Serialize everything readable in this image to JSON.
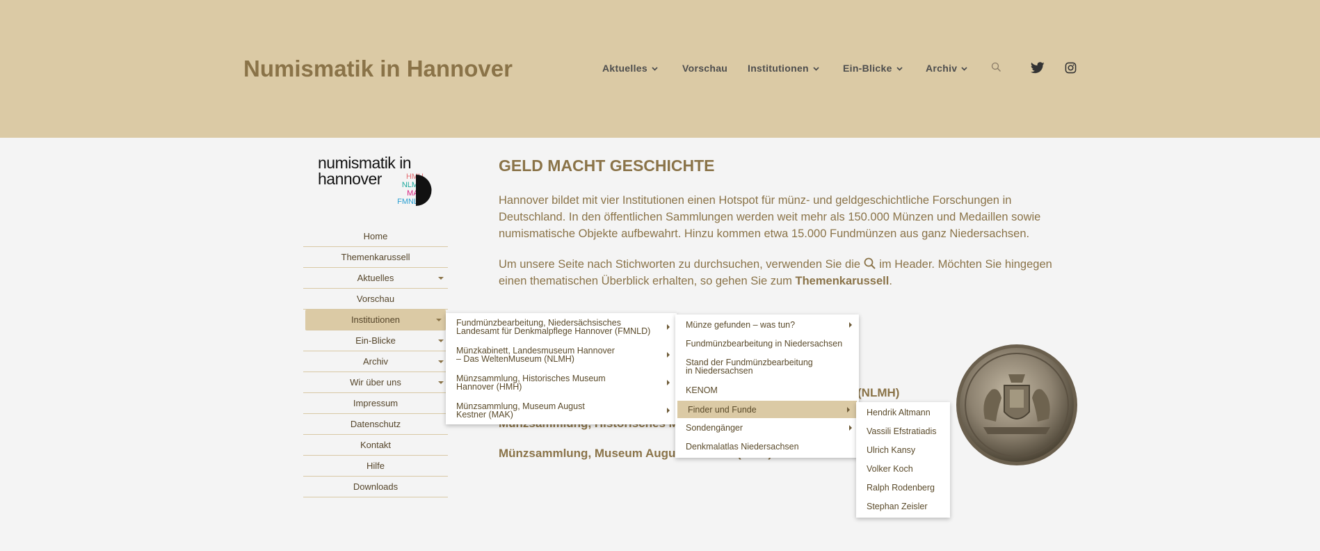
{
  "header": {
    "site_title": "Numismatik in Hannover",
    "nav": [
      {
        "label": "Aktuelles"
      },
      {
        "label": "Vorschau"
      },
      {
        "label": "Institutionen"
      },
      {
        "label": "Ein-Blicke"
      },
      {
        "label": "Archiv"
      }
    ],
    "icons": [
      "search-icon",
      "twitter-icon",
      "instagram-icon"
    ]
  },
  "logo": {
    "line1": "numismatik in",
    "line2": "hannover",
    "abbr": [
      "HMH",
      "NLMH",
      "MAK",
      "FMNLD"
    ],
    "abbr_colors": [
      "#e36f73",
      "#1aa89b",
      "#d6207f",
      "#2b9fd1"
    ]
  },
  "sidebar": {
    "items": [
      {
        "label": "Home"
      },
      {
        "label": "Themenkarussell"
      },
      {
        "label": "Aktuelles"
      },
      {
        "label": "Vorschau"
      },
      {
        "label": "Institutionen"
      },
      {
        "label": "Ein-Blicke"
      },
      {
        "label": "Archiv"
      },
      {
        "label": "Wir über uns"
      },
      {
        "label": "Impressum"
      },
      {
        "label": "Datenschutz"
      },
      {
        "label": "Kontakt"
      },
      {
        "label": "Hilfe"
      },
      {
        "label": "Downloads"
      }
    ]
  },
  "main": {
    "heading": "GELD MACHT GESCHICHTE",
    "para1": "Hannover bildet mit vier Institutionen einen Hotspot für münz- und geldgeschichtliche Forschungen in Deutschland. In den öffentlichen Sammlungen werden weit mehr als 150.000 Münzen und Medaillen sowie numismatische Objekte aufbewahrt. Hinzu kommen etwa 15.000 Fundmünzen aus ganz Niedersachsen.",
    "para2_before": "Um unsere Seite nach Stichworten zu durchsuchen, verwenden Sie die",
    "para2_after": "im Header. Möchten Sie hingegen einen thematischen Überblick erhalten, so gehen Sie zum",
    "para2_link": "Themenkarussell",
    "para2_end": ".",
    "inst_lines": [
      "(NLMH)",
      "Münzsammlung, Historisches M",
      "Münzsammlung, Museum Augu",
      "(MAK)"
    ]
  },
  "dropdown1": [
    {
      "line1": "Fundmünzbearbeitung, Niedersächsisches",
      "line2": "Landesamt für Denkmalpflege Hannover (FMNLD)"
    },
    {
      "line1": "Münzkabinett, Landesmuseum Hannover",
      "line2": "– Das WeltenMuseum (NLMH)"
    },
    {
      "line1": "Münzsammlung, Historisches Museum",
      "line2": "Hannover (HMH)"
    },
    {
      "line1": "Münzsammlung, Museum August",
      "line2": "Kestner (MAK)"
    }
  ],
  "dropdown2": [
    {
      "line1": "Münze gefunden – was tun?",
      "line2": ""
    },
    {
      "line1": "Fundmünzbearbeitung in Niedersachsen",
      "line2": ""
    },
    {
      "line1": "Stand der Fundmünzbearbeitung",
      "line2": "in Niedersachsen"
    },
    {
      "line1": "KENOM",
      "line2": ""
    },
    {
      "line1": "Finder und Funde",
      "line2": ""
    },
    {
      "line1": "Sondengänger",
      "line2": ""
    },
    {
      "line1": "Denkmalatlas Niedersachsen",
      "line2": ""
    }
  ],
  "dropdown3": [
    {
      "label": "Hendrik Altmann"
    },
    {
      "label": "Vassili Efstratiadis"
    },
    {
      "label": "Ulrich Kansy"
    },
    {
      "label": "Volker Koch"
    },
    {
      "label": "Ralph Rodenberg"
    },
    {
      "label": "Stephan Zeisler"
    }
  ],
  "colors": {
    "header_bg": "#dbcaa5",
    "accent": "#8a7348",
    "page_bg": "#f4f4f4"
  }
}
